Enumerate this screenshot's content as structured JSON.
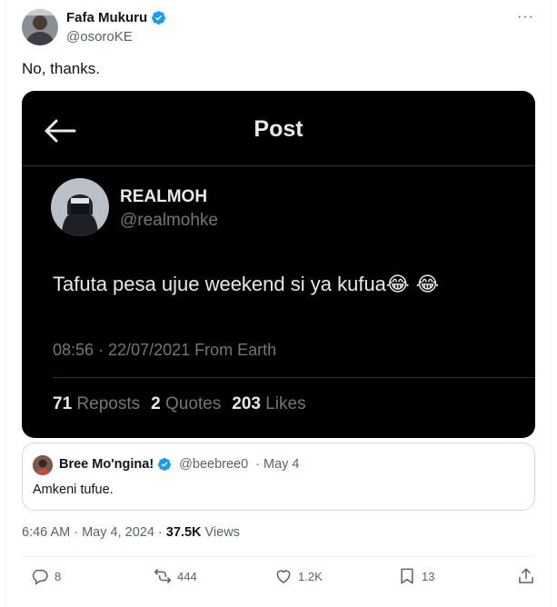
{
  "author": {
    "name": "Fafa Mukuru",
    "handle": "@osoroKE"
  },
  "more_label": "···",
  "tweet": {
    "text": "No, thanks."
  },
  "screenshot": {
    "header_title": "Post",
    "author_name": "REALMOH",
    "author_handle": "@realmohke",
    "text": "Tafuta pesa ujue weekend si ya kufua",
    "emoji": "😂 😂",
    "meta": "08:56 · 22/07/2021 From Earth",
    "stats": {
      "reposts_count": "71",
      "reposts_label": "Reposts",
      "quotes_count": "2",
      "quotes_label": "Quotes",
      "likes_count": "203",
      "likes_label": "Likes"
    }
  },
  "quoted": {
    "name": "Bree Mo'ngina!",
    "handle": "@beebree0",
    "date": "· May 4",
    "text": "Amkeni tufue."
  },
  "timestamp": {
    "time": "6:46 AM · May 4, 2024 · ",
    "views_count": "37.5K",
    "views_label": " Views"
  },
  "actions": {
    "replies": "8",
    "reposts": "444",
    "likes": "1.2K",
    "bookmarks": "13"
  },
  "colors": {
    "verified": "#1d9bf0",
    "secondary_text": "#536471",
    "dark_bg": "#000000"
  }
}
